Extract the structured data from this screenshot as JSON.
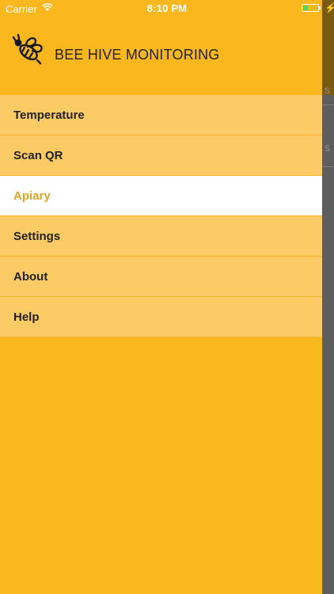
{
  "status_bar": {
    "carrier": "Carrier",
    "time": "8:10 PM",
    "battery_fill": 0.4,
    "wifi_icon": "wifi-icon",
    "charging_icon": "bolt-icon"
  },
  "header": {
    "title": "BEE HIVE MONITORING",
    "logo_icon": "bee-icon"
  },
  "menu": {
    "items": [
      {
        "label": "Temperature",
        "active": false
      },
      {
        "label": "Scan QR",
        "active": false
      },
      {
        "label": "Apiary",
        "active": true
      },
      {
        "label": "Settings",
        "active": false
      },
      {
        "label": "About",
        "active": false
      },
      {
        "label": "Help",
        "active": false
      }
    ]
  },
  "colors": {
    "drawer_bg": "#FBB81E",
    "menu_item_bg": "#FDCB66",
    "active_item_bg": "#FFFFFF",
    "active_item_text": "#D9A42A",
    "text": "#222222"
  }
}
